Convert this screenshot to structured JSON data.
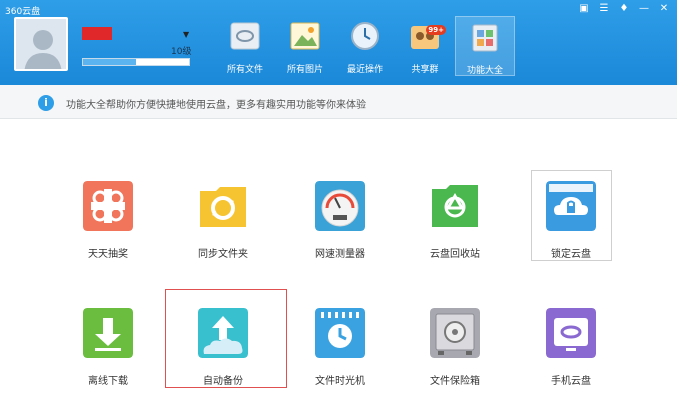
{
  "window": {
    "title": "360云盘"
  },
  "user": {
    "level": "10级",
    "progress_fraction": 0.5
  },
  "toolbar": [
    {
      "label": "所有文件",
      "icon": "all-files-icon"
    },
    {
      "label": "所有图片",
      "icon": "all-images-icon"
    },
    {
      "label": "最近操作",
      "icon": "recent-ops-icon"
    },
    {
      "label": "共享群",
      "icon": "share-group-icon",
      "badge": "99+"
    },
    {
      "label": "功能大全",
      "icon": "all-features-icon"
    }
  ],
  "info": {
    "text": "功能大全帮助你方便快捷地使用云盘，更多有趣实用功能等你来体验"
  },
  "features": [
    {
      "label": "天天抽奖",
      "icon": "lottery-icon"
    },
    {
      "label": "同步文件夹",
      "icon": "sync-folder-icon"
    },
    {
      "label": "网速测量器",
      "icon": "speed-meter-icon"
    },
    {
      "label": "云盘回收站",
      "icon": "recycle-bin-icon"
    },
    {
      "label": "锁定云盘",
      "icon": "lock-cloud-icon"
    },
    {
      "label": "离线下载",
      "icon": "offline-download-icon"
    },
    {
      "label": "自动备份",
      "icon": "auto-backup-icon"
    },
    {
      "label": "文件时光机",
      "icon": "time-machine-icon"
    },
    {
      "label": "文件保险箱",
      "icon": "file-safe-icon"
    },
    {
      "label": "手机云盘",
      "icon": "mobile-cloud-icon"
    }
  ],
  "colors": {
    "header": "#2f9ee8",
    "highlight": "#e05050"
  }
}
